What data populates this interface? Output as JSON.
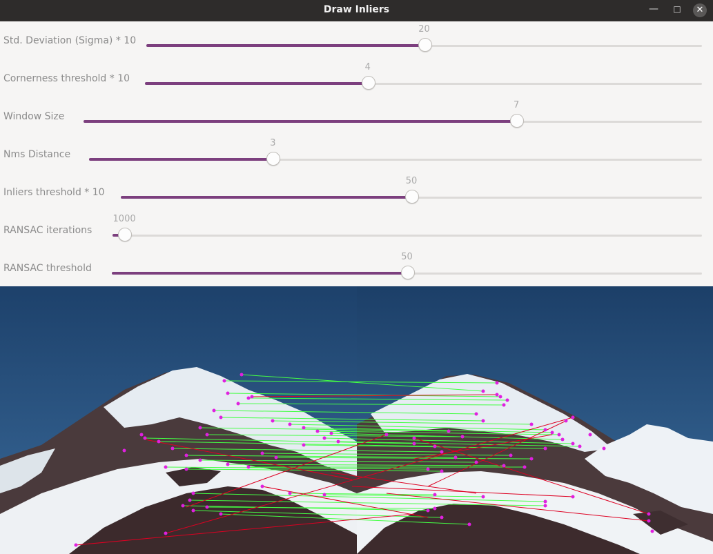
{
  "window": {
    "title": "Draw Inliers"
  },
  "sliders": [
    {
      "label": "Std. Deviation (Sigma) * 10",
      "value": 20,
      "fraction": 0.5
    },
    {
      "label": "Cornerness threshold * 10",
      "value": 4,
      "fraction": 0.4
    },
    {
      "label": "Window Size",
      "value": 7,
      "fraction": 0.7
    },
    {
      "label": "Nms Distance",
      "value": 3,
      "fraction": 0.3
    },
    {
      "label": "Inliers threshold * 10",
      "value": 50,
      "fraction": 0.5
    },
    {
      "label": "RANSAC iterations",
      "value": 1000,
      "fraction": 0.02
    },
    {
      "label": "RANSAC threshold",
      "value": 50,
      "fraction": 0.5
    }
  ],
  "colors": {
    "slider_fill": "#7c3f7e",
    "inlier_match": "#44ff44",
    "outlier_match": "#dd0022",
    "keypoint": "#e020e0",
    "sky": "#1e4a78"
  }
}
